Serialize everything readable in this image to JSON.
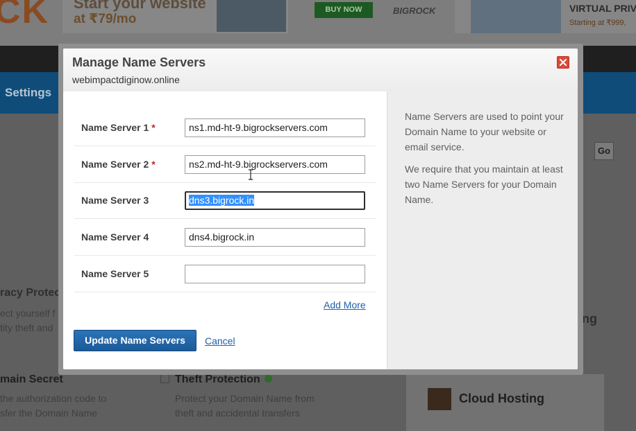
{
  "background": {
    "logo_text": "CK",
    "banner_left": {
      "line1": "Start your website",
      "line2": "at ₹79/mo"
    },
    "buy_now": "BUY NOW",
    "brand": "BIGROCK",
    "banner_right": {
      "title": "VIRTUAL PRIV",
      "subtitle": "Starting at ₹999,"
    },
    "nav_settings": "Settings",
    "go_button": "Go",
    "privacy": {
      "title": "racy Protec",
      "line1": "ect yourself f",
      "line2": "tity theft and"
    },
    "secret": {
      "title": "main Secret",
      "line1": "the authorization code to",
      "line2": "sfer the Domain Name"
    },
    "theft": {
      "title": "Theft Protection",
      "line1": "Protect your Domain Name from",
      "line2": "theft and accidental transfers"
    },
    "cloud_hosting": "Cloud Hosting",
    "ng_fragment": "ng"
  },
  "modal": {
    "title": "Manage Name Servers",
    "domain": "webimpactdiginow.online",
    "rows": [
      {
        "label": "Name Server 1",
        "required": "*",
        "value": "ns1.md-ht-9.bigrockservers.com"
      },
      {
        "label": "Name Server 2",
        "required": "*",
        "value": "ns2.md-ht-9.bigrockservers.com"
      },
      {
        "label": "Name Server 3",
        "required": "",
        "value": "dns3.bigrock.in"
      },
      {
        "label": "Name Server 4",
        "required": "",
        "value": "dns4.bigrock.in"
      },
      {
        "label": "Name Server 5",
        "required": "",
        "value": ""
      }
    ],
    "add_more": "Add More",
    "update_button": "Update Name Servers",
    "cancel": "Cancel",
    "info": {
      "p1": "Name Servers are used to point your Domain Name to your website or email service.",
      "p2": "We require that you maintain at least two Name Servers for your Domain Name."
    }
  },
  "colors": {
    "primary_button": "#1f64a6",
    "link": "#1f5fa8",
    "close": "#d94b3a",
    "required_mark": "#cc2222",
    "selection": "#3390ff"
  }
}
